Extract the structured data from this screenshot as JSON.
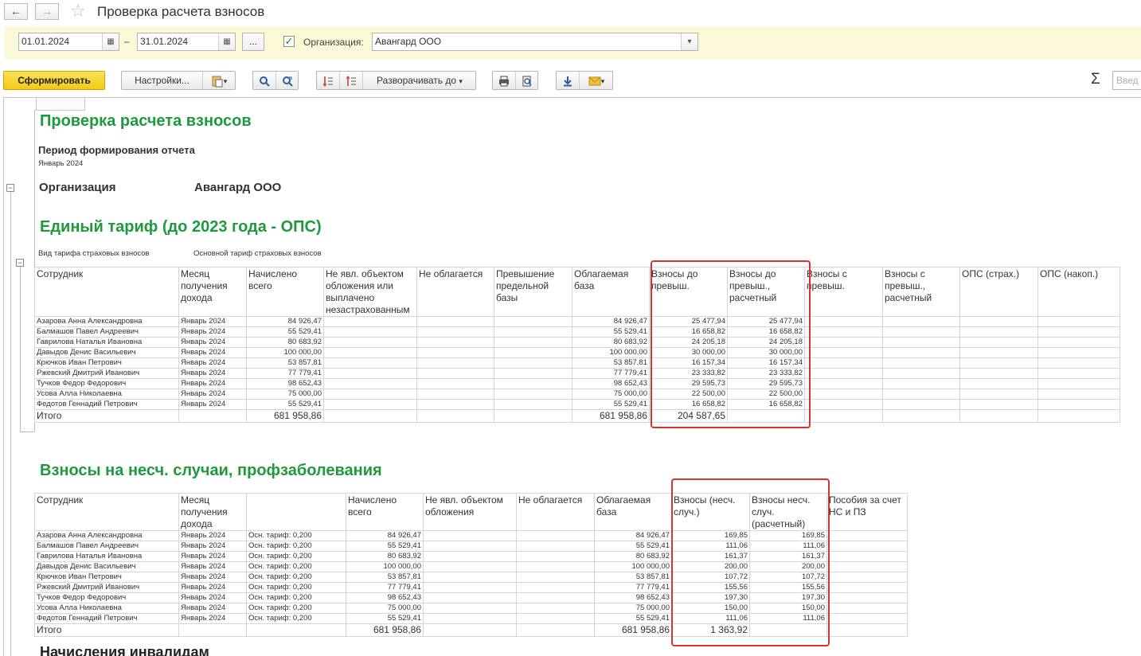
{
  "window": {
    "title": "Проверка расчета взносов",
    "back_icon": "←",
    "forward_icon": "→",
    "star_icon": "☆"
  },
  "params": {
    "date_from": "01.01.2024",
    "date_to": "31.01.2024",
    "dash": "–",
    "more": "...",
    "org_label": "Организация:",
    "org_value": "Авангард ООО",
    "org_checked": "✓"
  },
  "toolbar": {
    "generate": "Сформировать",
    "settings": "Настройки...",
    "expand_to": "Разворачивать до",
    "sigma": "Σ",
    "quick_placeholder": "Введ"
  },
  "report": {
    "title": "Проверка расчета взносов",
    "period_label": "Период формирования отчета",
    "period_value": "Январь 2024",
    "org_label": "Организация",
    "org_value": "Авангард ООО",
    "section1": {
      "title": "Единый тариф (до 2023 года - ОПС)",
      "tariff_label": "Вид тарифа страховых взносов",
      "tariff_value": "Основной тариф страховых взносов",
      "headers": [
        "Сотрудник",
        "Месяц получения дохода",
        "Начислено всего",
        "Не явл. объектом обложения или выплачено незастрахованным",
        "Не облагается",
        "Превышение предельной базы",
        "Облагаемая база",
        "Взносы до превыш.",
        "Взносы до превыш., расчетный",
        "Взносы с превыш.",
        "Взносы с превыш., расчетный",
        "ОПС (страх.)",
        "ОПС (накоп.)"
      ],
      "rows": [
        [
          "Азарова Анна Александровна",
          "Январь 2024",
          "84 926,47",
          "84 926,47",
          "25 477,94",
          "25 477,94"
        ],
        [
          "Балмашов Павел Андреевич",
          "Январь 2024",
          "55 529,41",
          "55 529,41",
          "16 658,82",
          "16 658,82"
        ],
        [
          "Гаврилова Наталья Ивановна",
          "Январь 2024",
          "80 683,92",
          "80 683,92",
          "24 205,18",
          "24 205,18"
        ],
        [
          "Давыдов Денис Васильевич",
          "Январь 2024",
          "100 000,00",
          "100 000,00",
          "30 000,00",
          "30 000,00"
        ],
        [
          "Крючков Иван Петрович",
          "Январь 2024",
          "53 857,81",
          "53 857,81",
          "16 157,34",
          "16 157,34"
        ],
        [
          "Ржевский Дмитрий Иванович",
          "Январь 2024",
          "77 779,41",
          "77 779,41",
          "23 333,82",
          "23 333,82"
        ],
        [
          "Тучков Федор Федорович",
          "Январь 2024",
          "98 652,43",
          "98 652,43",
          "29 595,73",
          "29 595,73"
        ],
        [
          "Усова Алла Николаевна",
          "Январь 2024",
          "75 000,00",
          "75 000,00",
          "22 500,00",
          "22 500,00"
        ],
        [
          "Федотов Геннадий Петрович",
          "Январь 2024",
          "55 529,41",
          "55 529,41",
          "16 658,82",
          "16 658,82"
        ]
      ],
      "total": {
        "label": "Итого",
        "accrued": "681 958,86",
        "base": "681 958,86",
        "contrib": "204 587,65"
      }
    },
    "section2": {
      "title": "Взносы на несч. случаи, профзаболевания",
      "headers": [
        "Сотрудник",
        "Месяц получения дохода",
        "",
        "Начислено всего",
        "Не явл. объектом обложения",
        "Не облагается",
        "Облагаемая база",
        "Взносы (несч. случ.)",
        "Взносы несч. случ. (расчетный)",
        "Пособия за счет НС и ПЗ"
      ],
      "rows": [
        [
          "Азарова Анна Александровна",
          "Январь 2024",
          "Осн. тариф: 0,200",
          "84 926,47",
          "84 926,47",
          "169,85",
          "169,85"
        ],
        [
          "Балмашов Павел Андреевич",
          "Январь 2024",
          "Осн. тариф: 0,200",
          "55 529,41",
          "55 529,41",
          "111,06",
          "111,06"
        ],
        [
          "Гаврилова Наталья Ивановна",
          "Январь 2024",
          "Осн. тариф: 0,200",
          "80 683,92",
          "80 683,92",
          "161,37",
          "161,37"
        ],
        [
          "Давыдов Денис Васильевич",
          "Январь 2024",
          "Осн. тариф: 0,200",
          "100 000,00",
          "100 000,00",
          "200,00",
          "200,00"
        ],
        [
          "Крючков Иван Петрович",
          "Январь 2024",
          "Осн. тариф: 0,200",
          "53 857,81",
          "53 857,81",
          "107,72",
          "107,72"
        ],
        [
          "Ржевский Дмитрий Иванович",
          "Январь 2024",
          "Осн. тариф: 0,200",
          "77 779,41",
          "77 779,41",
          "155,56",
          "155,56"
        ],
        [
          "Тучков Федор Федорович",
          "Январь 2024",
          "Осн. тариф: 0,200",
          "98 652,43",
          "98 652,43",
          "197,30",
          "197,30"
        ],
        [
          "Усова Алла Николаевна",
          "Январь 2024",
          "Осн. тариф: 0,200",
          "75 000,00",
          "75 000,00",
          "150,00",
          "150,00"
        ],
        [
          "Федотов Геннадий Петрович",
          "Январь 2024",
          "Осн. тариф: 0,200",
          "55 529,41",
          "55 529,41",
          "111,06",
          "111,06"
        ]
      ],
      "total": {
        "label": "Итого",
        "accrued": "681 958,86",
        "base": "681 958,86",
        "contrib": "1 363,92"
      }
    },
    "section3_title": "Начисления инвалидам"
  },
  "colors": {
    "accent_green": "#1e9a3c",
    "highlight_red": "#d9342b",
    "params_bg": "#fbf8d8",
    "generate_yellow": "#f5d327"
  }
}
